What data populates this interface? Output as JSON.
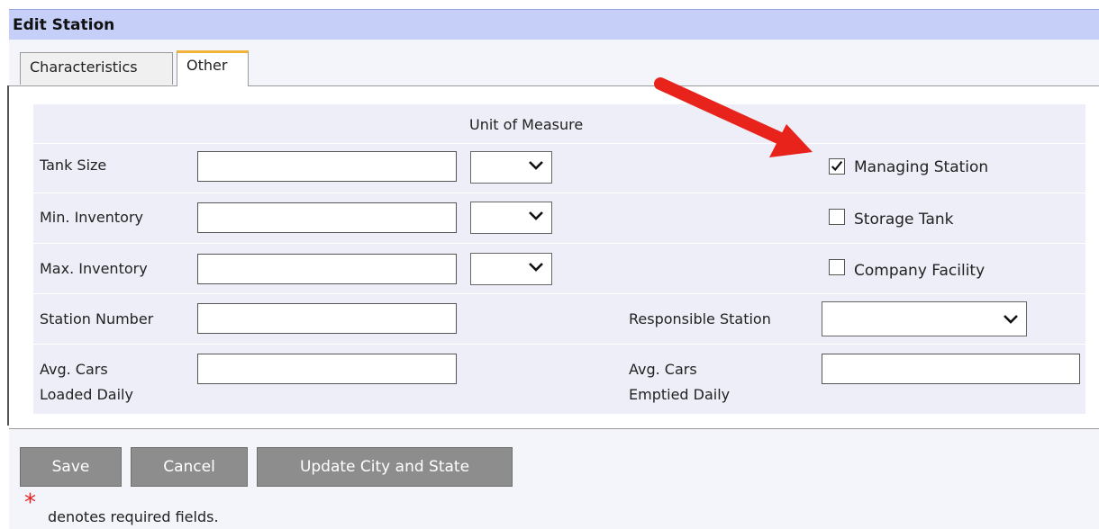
{
  "header": {
    "title": "Edit Station"
  },
  "tabs": [
    {
      "label": "Characteristics",
      "active": false
    },
    {
      "label": "Other",
      "active": true
    }
  ],
  "form": {
    "unit_of_measure_label": "Unit of Measure",
    "tank_size": {
      "label": "Tank Size",
      "value": "",
      "unit": ""
    },
    "min_inventory": {
      "label": "Min. Inventory",
      "value": "",
      "unit": ""
    },
    "max_inventory": {
      "label": "Max. Inventory",
      "value": "",
      "unit": ""
    },
    "station_number": {
      "label": "Station Number",
      "value": ""
    },
    "responsible_station": {
      "label": "Responsible Station",
      "value": ""
    },
    "avg_loaded": {
      "label_line1": "Avg. Cars",
      "label_line2": "Loaded Daily",
      "value": ""
    },
    "avg_emptied": {
      "label_line1": "Avg. Cars",
      "label_line2": "Emptied Daily",
      "value": ""
    },
    "checkboxes": [
      {
        "label": "Managing Station",
        "checked": true
      },
      {
        "label": "Storage Tank",
        "checked": false
      },
      {
        "label": "Company Facility",
        "checked": false
      }
    ]
  },
  "buttons": {
    "save": "Save",
    "cancel": "Cancel",
    "update": "Update City and State"
  },
  "footer": {
    "required_mark": "*",
    "required_note": "denotes required fields."
  },
  "colors": {
    "title_bar": "#c5cff8",
    "tab_accent": "#f1b33a",
    "button": "#8d8d8d",
    "arrow": "#e8231b",
    "required": "#e82020"
  }
}
